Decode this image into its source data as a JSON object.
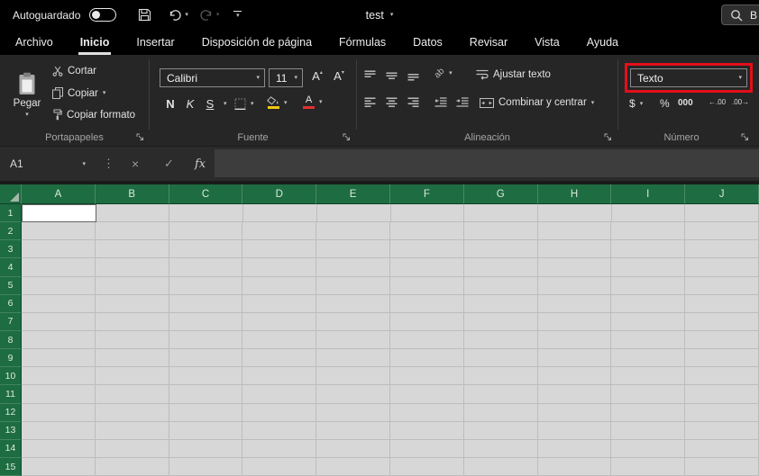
{
  "titlebar": {
    "autosave": "Autoguardado",
    "title": "test",
    "search": "B"
  },
  "tabs": [
    {
      "id": "archivo",
      "label": "Archivo",
      "active": false
    },
    {
      "id": "inicio",
      "label": "Inicio",
      "active": true
    },
    {
      "id": "insertar",
      "label": "Insertar",
      "active": false
    },
    {
      "id": "disposicion",
      "label": "Disposición de página",
      "active": false
    },
    {
      "id": "formulas",
      "label": "Fórmulas",
      "active": false
    },
    {
      "id": "datos",
      "label": "Datos",
      "active": false
    },
    {
      "id": "revisar",
      "label": "Revisar",
      "active": false
    },
    {
      "id": "vista",
      "label": "Vista",
      "active": false
    },
    {
      "id": "ayuda",
      "label": "Ayuda",
      "active": false
    }
  ],
  "ribbon": {
    "clipboard": {
      "group": "Portapapeles",
      "paste": "Pegar",
      "cut": "Cortar",
      "copy": "Copiar",
      "format_painter": "Copiar formato"
    },
    "font": {
      "group": "Fuente",
      "family": "Calibri",
      "size": "11",
      "bold": "N",
      "italic": "K",
      "underline": "S",
      "fill_color": "#f2c811",
      "font_color": "#e03131"
    },
    "alignment": {
      "group": "Alineación",
      "wrap": "Ajustar texto",
      "merge": "Combinar y centrar"
    },
    "number": {
      "group": "Número",
      "format": "Texto",
      "currency": "$",
      "percent": "%",
      "thousands": "000",
      "increase_decimal": "←.00",
      "decrease_decimal": ".00→",
      "highlight_color": "#e40f1a"
    }
  },
  "formula_bar": {
    "name_box": "A1",
    "cancel": "×",
    "enter": "✓",
    "fx": "fx"
  },
  "grid": {
    "columns": [
      "A",
      "B",
      "C",
      "D",
      "E",
      "F",
      "G",
      "H",
      "I",
      "J"
    ],
    "rows": [
      "1",
      "2",
      "3",
      "4",
      "5",
      "6",
      "7",
      "8",
      "9",
      "10",
      "11",
      "12",
      "13",
      "14",
      "15"
    ],
    "selected": "A1",
    "header_color": "#1e6c41",
    "cell_color": "#d7d7d7"
  },
  "icons": {
    "dropdown-chevron": "▾",
    "separator-dots": "⋮"
  }
}
